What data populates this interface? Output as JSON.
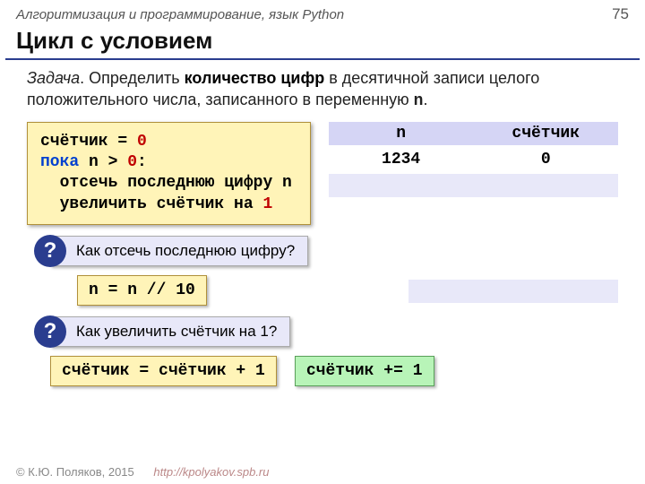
{
  "header": {
    "course": "Алгоритмизация и программирование, язык Python",
    "page": "75"
  },
  "title": "Цикл с условием",
  "task": {
    "lead": "Задача",
    "body_a": ". Определить ",
    "bold": "количество цифр",
    "body_b": " в десятичной записи целого положительного числа, записанного в переменную ",
    "var": "n",
    "body_c": "."
  },
  "pseudo": {
    "l1a": "счётчик = ",
    "l1b": "0",
    "l2a": "пока",
    "l2b": " n > ",
    "l2c": "0",
    "l2d": ":",
    "l3": "  отсечь последнюю цифру n",
    "l4a": "  увеличить счётчик на ",
    "l4b": "1"
  },
  "table": {
    "h1": "n",
    "h2": "счётчик",
    "r1c1": "1234",
    "r1c2": "0",
    "r2c1": "",
    "r2c2": ""
  },
  "q1": {
    "badge": "?",
    "text": " Как отсечь последнюю цифру?"
  },
  "ans1": {
    "a": "n = n // ",
    "b": "10"
  },
  "q2": {
    "badge": "?",
    "text": " Как увеличить счётчик на 1?"
  },
  "ans2": {
    "a": "счётчик = счётчик + ",
    "b": "1"
  },
  "ans3": {
    "a": "счётчик += ",
    "b": "1"
  },
  "footer": {
    "copy": "© К.Ю. Поляков, 2015",
    "url": "http://kpolyakov.spb.ru"
  }
}
